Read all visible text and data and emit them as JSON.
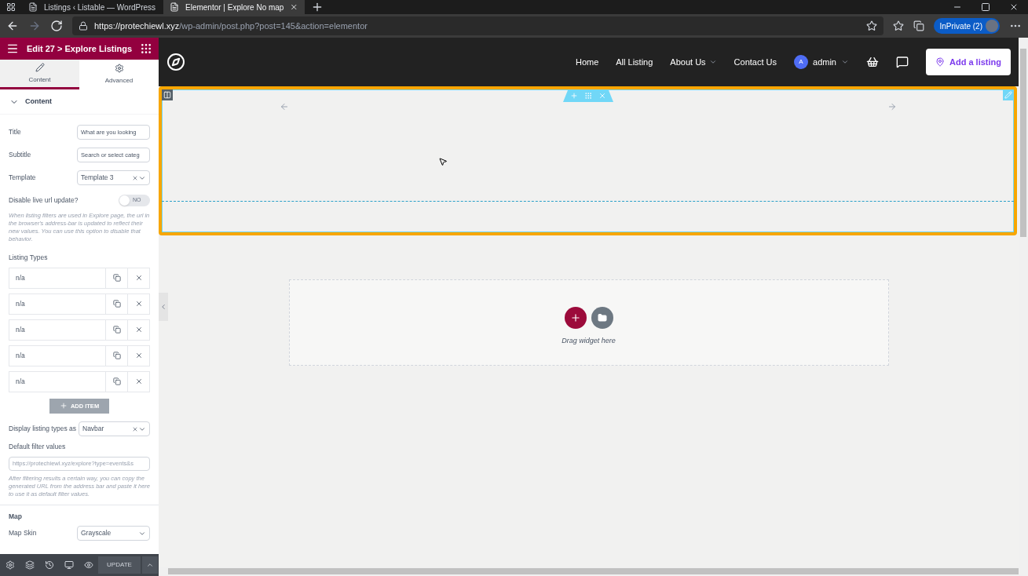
{
  "browser": {
    "tabs": [
      {
        "title": "Listings ‹ Listable — WordPress",
        "selected": false
      },
      {
        "title": "Elementor | Explore No map",
        "selected": true
      }
    ],
    "url": {
      "host": "https://protechiewl.xyz",
      "path": "/wp-admin/post.php?post=145&action=elementor"
    },
    "profile": "InPrivate (2)"
  },
  "panel": {
    "title": "Edit 27 > Explore Listings",
    "tabs": [
      {
        "label": "Content",
        "kind": "pencil",
        "selected": true
      },
      {
        "label": "Advanced",
        "kind": "gear",
        "selected": false
      }
    ],
    "section": "Content",
    "fields": [
      {
        "kind": "text",
        "label": "Title",
        "value": "What are you looking"
      },
      {
        "kind": "text",
        "label": "Subtitle",
        "value": "Search or select categ"
      },
      {
        "kind": "select",
        "label": "Template",
        "value": "Template 3"
      },
      {
        "kind": "toggle",
        "label": "Disable live url update?",
        "on": false,
        "state_text": "NO"
      }
    ],
    "toggle_help": "When listing filters are used in Explore page, the url in the browser's address-bar is updated to reflect their new values. You can use this option to disable that behavior.",
    "listing_types_label": "Listing Types",
    "listing_types": [
      {
        "value": "n/a"
      },
      {
        "value": "n/a"
      },
      {
        "value": "n/a"
      },
      {
        "value": "n/a"
      },
      {
        "value": "n/a"
      }
    ],
    "add_item": "ADD ITEM",
    "display_label": "Display listing types as",
    "display_value": "Navbar",
    "filter_label": "Default filter values",
    "filter_placeholder": "https://protechiewl.xyz/explore?type=events&s",
    "filter_help": "After filtering results a certain way, you can copy the generated URL from the address bar and paste it here to use it as default filter values.",
    "map_section": "Map",
    "map_skin_label": "Map Skin",
    "map_skin_value": "Grayscale",
    "update": "UPDATE"
  },
  "site": {
    "nav": [
      {
        "label": "Home",
        "dropdown": false
      },
      {
        "label": "All Listing",
        "dropdown": false
      },
      {
        "label": "About Us",
        "dropdown": true
      },
      {
        "label": "Contact Us",
        "dropdown": false
      }
    ],
    "avatar": "A",
    "user": "admin",
    "cta": "Add a listing"
  },
  "canvas": {
    "drop_hint": "Drag widget here"
  }
}
